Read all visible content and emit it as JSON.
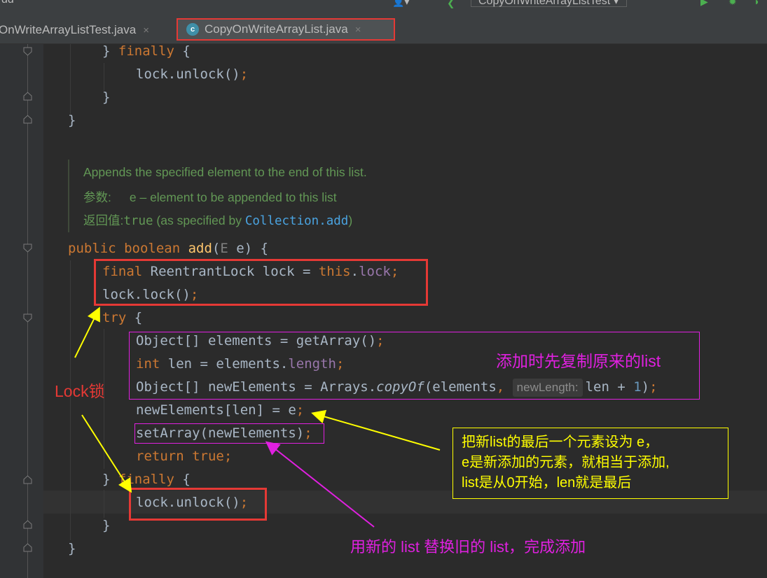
{
  "window": {
    "title_fragment": "dd",
    "run_config": "CopyOnWriteArrayListTest"
  },
  "tabs": [
    {
      "label": "OnWriteArrayListTest.java",
      "close": "×"
    },
    {
      "label": "CopyOnWriteArrayList.java",
      "close": "×",
      "icon": "c"
    }
  ],
  "code": {
    "l1a": "} ",
    "l1b": "finally",
    "l1c": " {",
    "l2a": "lock.unlock()",
    "l2b": ";",
    "l3": "}",
    "l4": "}",
    "doc1": "Appends the specified element to the end of this list.",
    "doc2a": "参数:",
    "doc2b": "e – element to be appended to this list",
    "doc3a": "返回值:",
    "doc3b": "true",
    "doc3c": " (as specified by ",
    "doc3d": "Collection.add",
    "doc3e": ")",
    "m1a": "public boolean ",
    "m1b": "add",
    "m1c": "(",
    "m1d": "E",
    "m1e": " e) {",
    "m2a": "final ",
    "m2b": "ReentrantLock lock = ",
    "m2c": "this",
    "m2d": ".",
    "m2e": "lock",
    "m2f": ";",
    "m3a": "lock.lock()",
    "m3b": ";",
    "m4a": "try",
    "m4b": " {",
    "m5a": "Object[] elements = getArray()",
    "m5b": ";",
    "m6a": "int ",
    "m6b": "len = elements.",
    "m6c": "length",
    "m6d": ";",
    "m7a": "Object[] newElements = Arrays.",
    "m7b": "copyOf",
    "m7c": "(elements",
    "m7d": ", ",
    "m7e": "newLength:",
    "m7f": "len + ",
    "m7g": "1",
    "m7h": ")",
    "m7i": ";",
    "m8a": "newElements[len] = e",
    "m8b": ";",
    "m9a": "setArray(newElements)",
    "m9b": ";",
    "m10a": "return ",
    "m10b": "true",
    "m10c": ";",
    "m11a": "} ",
    "m11b": "finally",
    "m11c": " {",
    "m12a": "lock.unlock()",
    "m12b": ";",
    "m13": "}",
    "m14": "}"
  },
  "annotations": {
    "lock": "Lock锁",
    "copy": "添加时先复制原来的list",
    "note_lines": [
      "把新list的最后一个元素设为 e，",
      "e是新添加的元素，就相当于添加,",
      "list是从0开始，len就是最后"
    ],
    "replace": "用新的 list 替换旧的 list，完成添加"
  },
  "colors": {
    "red": "#e53935",
    "magenta": "#e020e0",
    "yellow": "#ffff00",
    "keyword": "#cc7832",
    "method": "#ffc66d",
    "field": "#9876aa",
    "doc": "#629755"
  }
}
